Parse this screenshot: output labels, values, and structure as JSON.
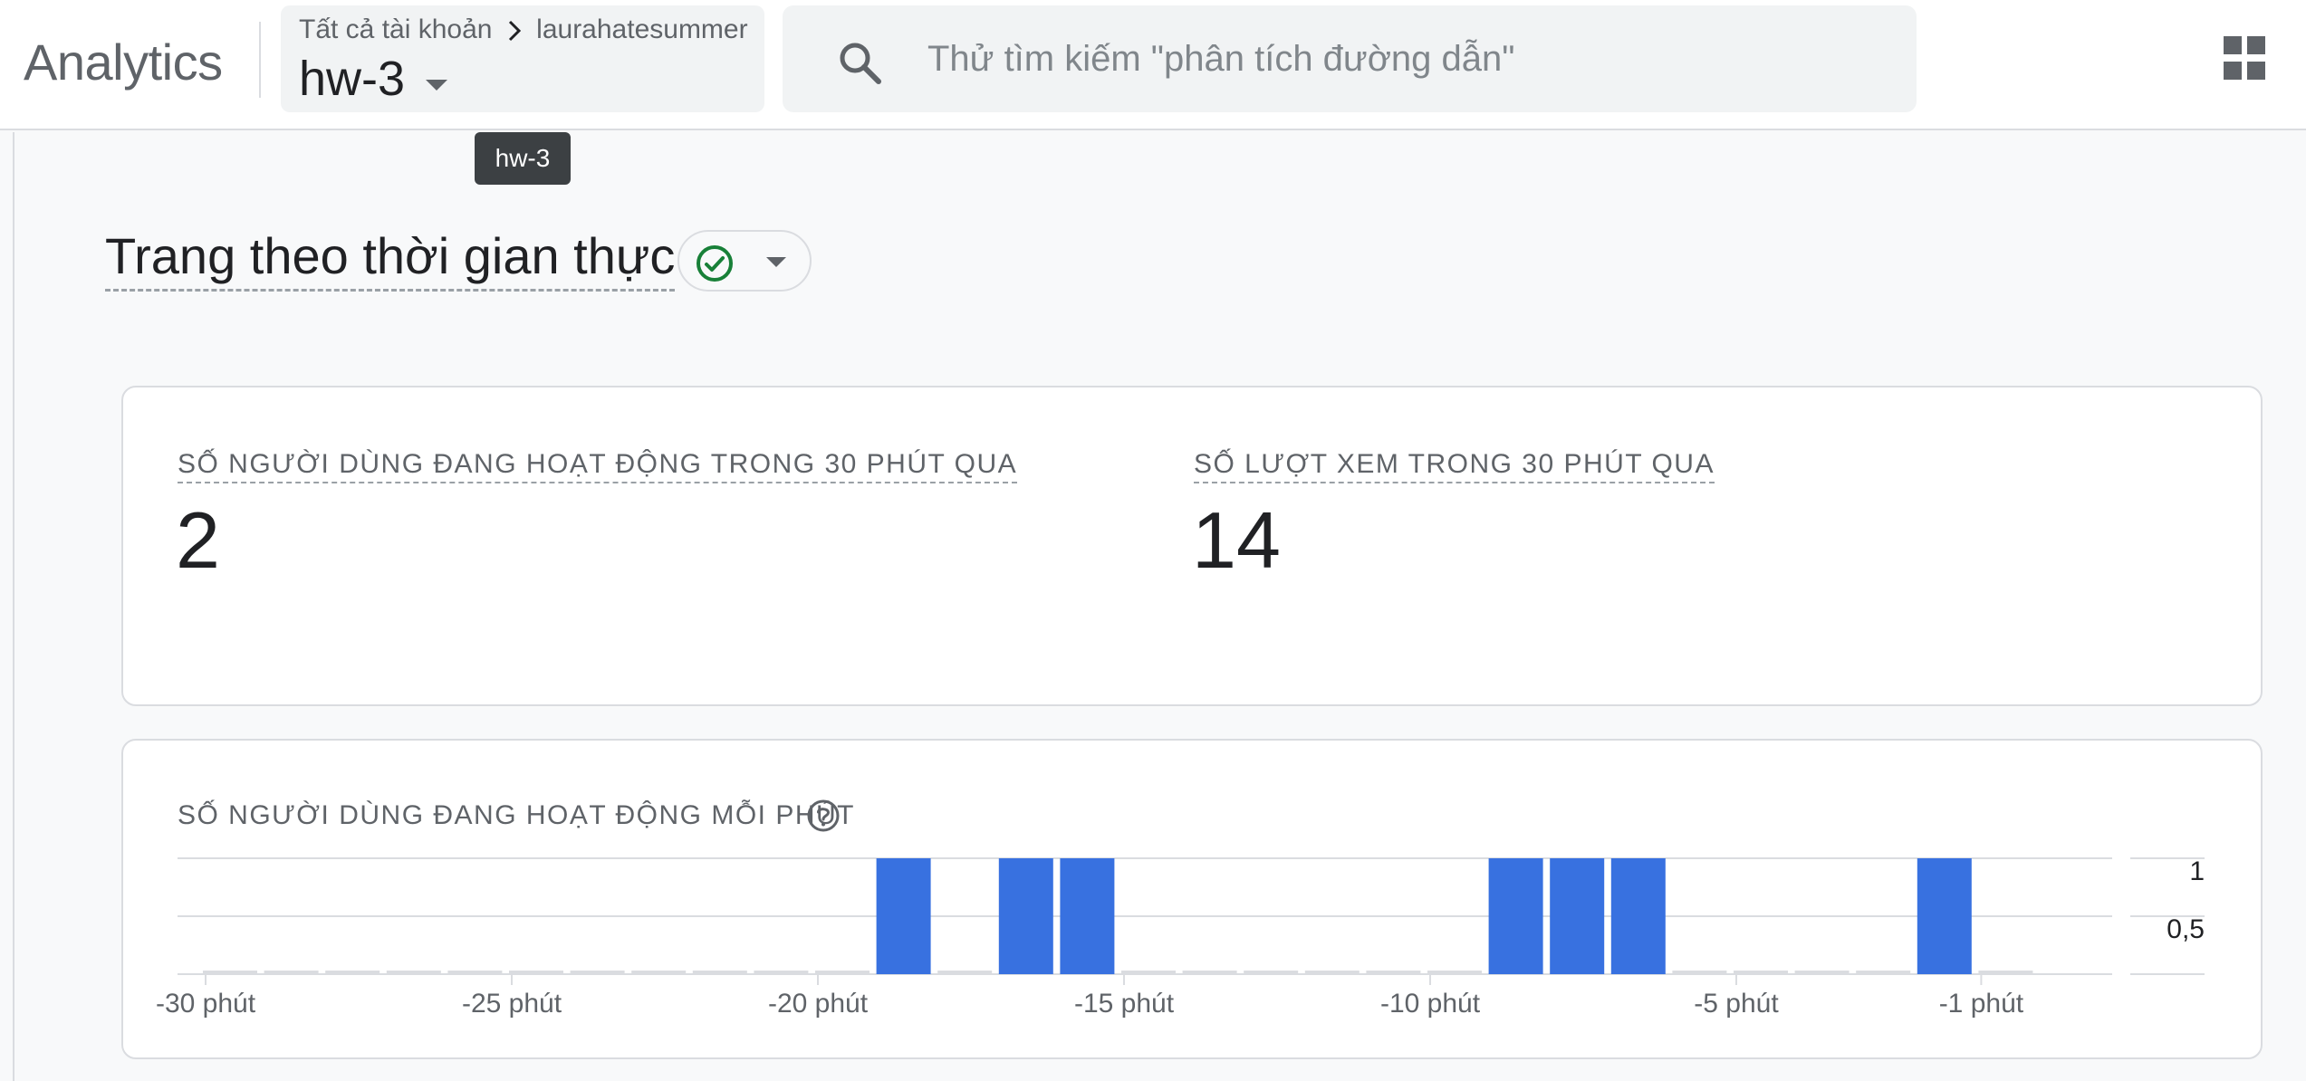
{
  "app": {
    "title": "Analytics"
  },
  "property_picker": {
    "breadcrumb": [
      "Tất cả tài khoản",
      "laurahatesummer"
    ],
    "property": "hw-3"
  },
  "search": {
    "placeholder": "Thử tìm kiếm \"phân tích đường dẫn\"",
    "value": ""
  },
  "tooltip": {
    "text": "hw-3"
  },
  "page": {
    "title": "Trang theo thời gian thực",
    "status": "ok"
  },
  "metrics": [
    {
      "label": "SỐ NGƯỜI DÙNG ĐANG HOẠT ĐỘNG TRONG 30 PHÚT QUA",
      "value": "2"
    },
    {
      "label": "SỐ LƯỢT XEM TRONG 30 PHÚT QUA",
      "value": "14"
    }
  ],
  "chart_card": {
    "title": "SỐ NGƯỜI DÙNG ĐANG HOẠT ĐỘNG MỖI PHÚT"
  },
  "chart_data": {
    "type": "bar",
    "title": "SỐ NGƯỜI DÙNG ĐANG HOẠT ĐỘNG MỖI PHÚT",
    "categories": [
      -30,
      -29,
      -28,
      -27,
      -26,
      -25,
      -24,
      -23,
      -22,
      -21,
      -20,
      -19,
      -18,
      -17,
      -16,
      -15,
      -14,
      -13,
      -12,
      -11,
      -10,
      -9,
      -8,
      -7,
      -6,
      -5,
      -4,
      -3,
      -2,
      -1
    ],
    "values": [
      0,
      0,
      0,
      0,
      0,
      0,
      0,
      0,
      0,
      0,
      0,
      1,
      0,
      1,
      1,
      0,
      0,
      0,
      0,
      0,
      0,
      1,
      1,
      1,
      0,
      0,
      0,
      0,
      1,
      0
    ],
    "x_ticks": [
      {
        "minute": -30,
        "label": "-30 phút"
      },
      {
        "minute": -25,
        "label": "-25 phút"
      },
      {
        "minute": -20,
        "label": "-20 phút"
      },
      {
        "minute": -15,
        "label": "-15 phút"
      },
      {
        "minute": -10,
        "label": "-10 phút"
      },
      {
        "minute": -5,
        "label": "-5 phút"
      },
      {
        "minute": -1,
        "label": "-1 phút"
      }
    ],
    "y_ticks": [
      {
        "value": 1,
        "label": "1"
      },
      {
        "value": 0.5,
        "label": "0,5"
      }
    ],
    "ylim": [
      0,
      1
    ],
    "grid": true,
    "bar_color": "#3871e0",
    "zero_bar_color": "#dadce0"
  },
  "colors": {
    "accent": "#3871e0",
    "status_ok": "#188038",
    "text_primary": "#202124",
    "text_secondary": "#5f6368"
  },
  "icons": {
    "search": "search-icon",
    "apps": "apps-grid-icon",
    "status": "check-circle-icon",
    "help": "help-icon",
    "caret": "caret-down-icon"
  }
}
